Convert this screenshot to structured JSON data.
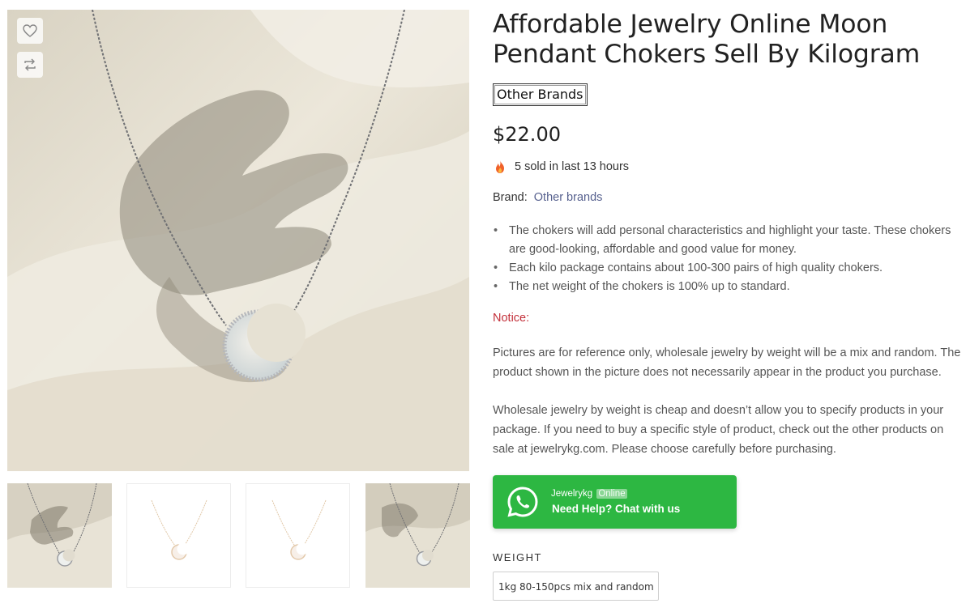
{
  "product": {
    "title": "Affordable Jewelry Online Moon Pendant Chokers Sell By Kilogram",
    "brand_badge": "Other Brands",
    "price": "$22.00",
    "sold_text": "5 sold in last 13 hours",
    "brand_label": "Brand:",
    "brand_link": "Other brands",
    "bullets": [
      "The chokers will add personal characteristics and highlight your taste. These chokers are good-looking, affordable and good value for money.",
      "Each kilo package contains about 100-300 pairs of high quality chokers.",
      "The net weight of the chokers is 100% up to standard."
    ],
    "notice_label": "Notice:",
    "paragraphs": [
      "Pictures are for reference only, wholesale jewelry by weight will be a mix and random. The product shown in the picture does not necessarily appear in the product you purchase.",
      "Wholesale jewelry by weight is cheap and doesn’t allow you to specify products in your package. If you need to buy a specific style of product, check out the other products on sale at jewelrykg.com. Please choose carefully before purchasing."
    ]
  },
  "chat": {
    "name": "Jewelrykg",
    "status": "Online",
    "cta": "Need Help? Chat with us",
    "icon": "whatsapp-icon",
    "color": "#2db742"
  },
  "options": {
    "weight_label": "WEIGHT",
    "weight_values": [
      "1kg 80-150pcs mix and random"
    ],
    "selected_weight": "1kg 80-150pcs mix and random"
  },
  "gallery": {
    "actions": [
      {
        "icon": "heart-icon"
      },
      {
        "icon": "compare-icon"
      }
    ],
    "thumbnail_count": 4
  },
  "colors": {
    "notice": "#c3303a",
    "brand_link": "#56608e",
    "chat_green": "#2db742"
  }
}
